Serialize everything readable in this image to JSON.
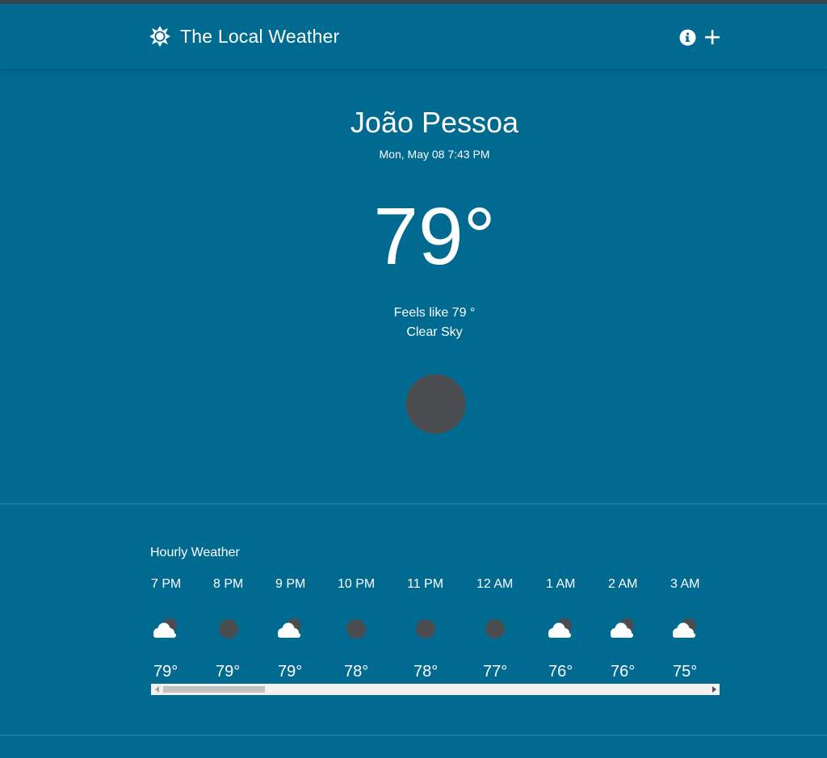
{
  "app": {
    "title": "The Local Weather",
    "icons": [
      "sun-icon",
      "info-icon",
      "plus-icon"
    ]
  },
  "current": {
    "city": "João Pessoa",
    "datetime": "Mon, May 08 7:43 PM",
    "temperature": "79°",
    "feels_like": "Feels like 79 °",
    "description": "Clear Sky",
    "icon": "clear-night-icon"
  },
  "hourly": {
    "title": "Hourly Weather",
    "items": [
      {
        "time": "7 PM",
        "temp": "79°",
        "icon": "partly-cloudy-night-icon"
      },
      {
        "time": "8 PM",
        "temp": "79°",
        "icon": "clear-night-icon"
      },
      {
        "time": "9 PM",
        "temp": "79°",
        "icon": "partly-cloudy-night-icon"
      },
      {
        "time": "10 PM",
        "temp": "78°",
        "icon": "clear-night-icon"
      },
      {
        "time": "11 PM",
        "temp": "78°",
        "icon": "clear-night-icon"
      },
      {
        "time": "12 AM",
        "temp": "77°",
        "icon": "clear-night-icon"
      },
      {
        "time": "1 AM",
        "temp": "76°",
        "icon": "partly-cloudy-night-icon"
      },
      {
        "time": "2 AM",
        "temp": "76°",
        "icon": "partly-cloudy-night-icon"
      },
      {
        "time": "3 AM",
        "temp": "75°",
        "icon": "partly-cloudy-night-icon"
      }
    ]
  },
  "colors": {
    "background": "#006a90",
    "top_strip": "#37474f",
    "moon": "#4a4c50",
    "cloud": "#ffffff",
    "text": "#ffffff"
  }
}
